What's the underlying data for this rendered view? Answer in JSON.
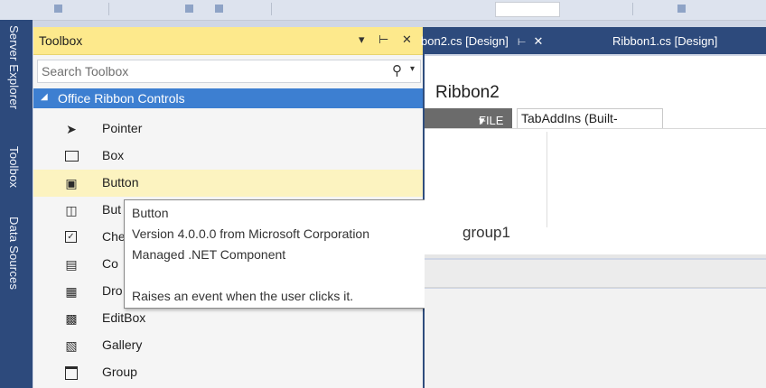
{
  "rail": {
    "tabs": [
      "Server Explorer",
      "Toolbox",
      "Data Sources"
    ]
  },
  "toolbox": {
    "title": "Toolbox",
    "header_icons": [
      "dropdown-icon",
      "pin-icon",
      "close-icon"
    ],
    "search_placeholder": "Search Toolbox",
    "category": "Office Ribbon Controls",
    "items": [
      {
        "label": "Pointer",
        "icon": "pointer-icon"
      },
      {
        "label": "Box",
        "icon": "box-icon"
      },
      {
        "label": "Button",
        "icon": "button-icon",
        "selected": true
      },
      {
        "label": "ButtonGroup",
        "icon": "buttongroup-icon"
      },
      {
        "label": "CheckBox",
        "icon": "checkbox-icon"
      },
      {
        "label": "ComboBox",
        "icon": "combobox-icon"
      },
      {
        "label": "DropDown",
        "icon": "dropdown-control-icon"
      },
      {
        "label": "EditBox",
        "icon": "editbox-icon"
      },
      {
        "label": "Gallery",
        "icon": "gallery-icon"
      },
      {
        "label": "Group",
        "icon": "group-icon"
      }
    ],
    "visible_labels": [
      "Pointer",
      "Box",
      "Button",
      "But",
      "Che",
      "Co",
      "Dro",
      "EditBox",
      "Gallery",
      "Group"
    ]
  },
  "tooltip": {
    "title": "Button",
    "version": "Version 4.0.0.0 from Microsoft Corporation",
    "kind": "Managed .NET Component",
    "description": "Raises an event when the user clicks it."
  },
  "documents": {
    "tabs": [
      {
        "label": "bon2.cs [Design]",
        "active": false
      },
      {
        "label": "Ribbon1.cs [Design]",
        "active": false
      }
    ],
    "ribbon_name": "Ribbon2",
    "file_tab": "FILE",
    "addins_tab": "TabAddIns (Built-",
    "group_label": "group1"
  },
  "colors": {
    "accent": "#3d7fd1",
    "header_yellow": "#fde98c",
    "rail_blue": "#2d4a7c",
    "selected_item": "#fcf3c0"
  }
}
